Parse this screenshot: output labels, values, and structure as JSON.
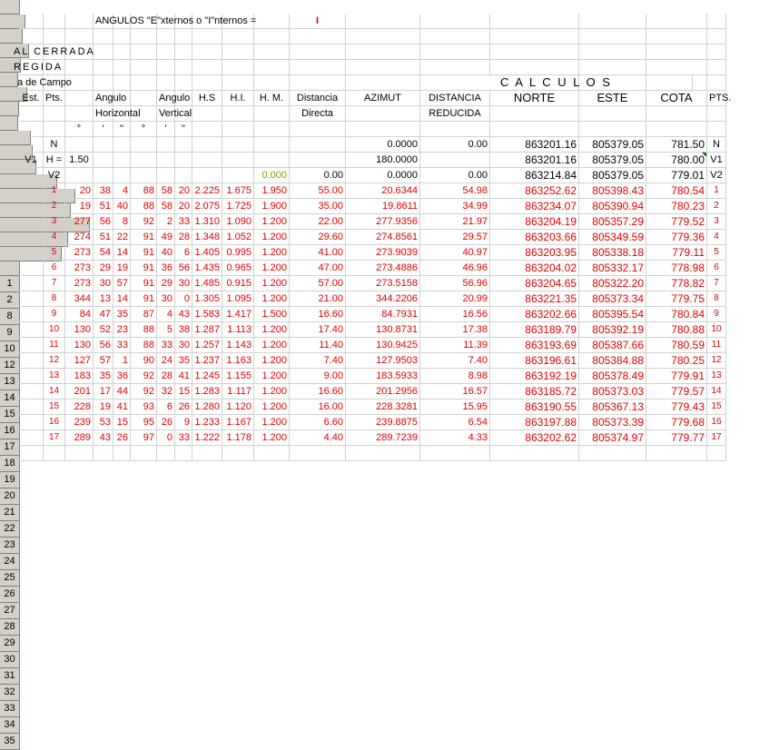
{
  "columns": [
    "A",
    "B",
    "C",
    "D",
    "E",
    "F",
    "G",
    "H",
    "I",
    "J",
    "K",
    "L",
    "U",
    "V",
    "W",
    "X",
    "Y",
    "Z"
  ],
  "texts": {
    "1": {
      "D": "ANGULOS  \"E\"xternos  o  \"I\"nternos  =",
      "L": "I"
    },
    "8": {
      "A": "AL  CERRADA"
    },
    "9": {
      "A": "REGIDA"
    },
    "10": {
      "A": "a  de  Campo",
      "V": "C A L C U L O S"
    },
    "12": {
      "A": "Est.",
      "B": "Pts.",
      "D": "Angulo",
      "G": "Angulo",
      "I": "H.S",
      "J": "H.I.",
      "K": "H. M.",
      "L": "Distancia",
      "U": "AZIMUT",
      "V": "DISTANCIA",
      "W": "NORTE",
      "X": "ESTE",
      "Y": "COTA",
      "Z": "PTS."
    },
    "13": {
      "D": "Horizontal",
      "G": "Vertical",
      "L": "Directa",
      "V": "REDUCIDA"
    },
    "14": {
      "C": "°",
      "D": "'",
      "E": "\"",
      "F": "°",
      "G": "'",
      "H": "\""
    },
    "15": {
      "B": "N",
      "U": "0.0000",
      "V": "0.00",
      "W": "863201.16",
      "X": "805379.05",
      "Y": "781.50",
      "Z": "N"
    },
    "16": {
      "A": "V1",
      "B": "H =",
      "C": "1.50",
      "U": "180.0000",
      "W": "863201.16",
      "X": "805379.05",
      "Y": "780.00",
      "Z": "V1"
    },
    "17": {
      "B": "V2",
      "K": "0.000",
      "L": "0.00",
      "U": "0.0000",
      "V": "0.00",
      "W": "863214.84",
      "X": "805379.05",
      "Y": "779.01",
      "Z": "V2"
    }
  },
  "data_rows": [
    {
      "row": "18",
      "pt": "1",
      "h_deg": "20",
      "h_min": "38",
      "h_sec": "4",
      "v_deg": "88",
      "v_min": "58",
      "v_sec": "20",
      "hs": "2.225",
      "hi": "1.675",
      "hm": "1.950",
      "dist": "55.00",
      "azimut": "20.6344",
      "dred": "54.98",
      "norte": "863252.62",
      "este": "805398.43",
      "cota": "780.54",
      "pts": "1"
    },
    {
      "row": "19",
      "pt": "2",
      "h_deg": "19",
      "h_min": "51",
      "h_sec": "40",
      "v_deg": "88",
      "v_min": "58",
      "v_sec": "20",
      "hs": "2.075",
      "hi": "1.725",
      "hm": "1.900",
      "dist": "35.00",
      "azimut": "19.8611",
      "dred": "34.99",
      "norte": "863234.07",
      "este": "805390.94",
      "cota": "780.23",
      "pts": "2"
    },
    {
      "row": "20",
      "pt": "3",
      "h_deg": "277",
      "h_min": "56",
      "h_sec": "8",
      "v_deg": "92",
      "v_min": "2",
      "v_sec": "33",
      "hs": "1.310",
      "hi": "1.090",
      "hm": "1.200",
      "dist": "22.00",
      "azimut": "277.9356",
      "dred": "21.97",
      "norte": "863204.19",
      "este": "805357.29",
      "cota": "779.52",
      "pts": "3"
    },
    {
      "row": "21",
      "pt": "4",
      "h_deg": "274",
      "h_min": "51",
      "h_sec": "22",
      "v_deg": "91",
      "v_min": "49",
      "v_sec": "28",
      "hs": "1.348",
      "hi": "1.052",
      "hm": "1.200",
      "dist": "29.60",
      "azimut": "274.8561",
      "dred": "29.57",
      "norte": "863203.66",
      "este": "805349.59",
      "cota": "779.36",
      "pts": "4"
    },
    {
      "row": "22",
      "pt": "5",
      "h_deg": "273",
      "h_min": "54",
      "h_sec": "14",
      "v_deg": "91",
      "v_min": "40",
      "v_sec": "6",
      "hs": "1.405",
      "hi": "0.995",
      "hm": "1.200",
      "dist": "41.00",
      "azimut": "273.9039",
      "dred": "40.97",
      "norte": "863203.95",
      "este": "805338.18",
      "cota": "779.11",
      "pts": "5"
    },
    {
      "row": "23",
      "pt": "6",
      "h_deg": "273",
      "h_min": "29",
      "h_sec": "19",
      "v_deg": "91",
      "v_min": "36",
      "v_sec": "56",
      "hs": "1.435",
      "hi": "0.965",
      "hm": "1.200",
      "dist": "47.00",
      "azimut": "273.4886",
      "dred": "46.96",
      "norte": "863204.02",
      "este": "805332.17",
      "cota": "778.98",
      "pts": "6"
    },
    {
      "row": "24",
      "pt": "7",
      "h_deg": "273",
      "h_min": "30",
      "h_sec": "57",
      "v_deg": "91",
      "v_min": "29",
      "v_sec": "30",
      "hs": "1.485",
      "hi": "0.915",
      "hm": "1.200",
      "dist": "57.00",
      "azimut": "273.5158",
      "dred": "56.96",
      "norte": "863204.65",
      "este": "805322.20",
      "cota": "778.82",
      "pts": "7"
    },
    {
      "row": "25",
      "pt": "8",
      "h_deg": "344",
      "h_min": "13",
      "h_sec": "14",
      "v_deg": "91",
      "v_min": "30",
      "v_sec": "0",
      "hs": "1.305",
      "hi": "1.095",
      "hm": "1.200",
      "dist": "21.00",
      "azimut": "344.2206",
      "dred": "20.99",
      "norte": "863221.35",
      "este": "805373.34",
      "cota": "779.75",
      "pts": "8"
    },
    {
      "row": "26",
      "pt": "9",
      "h_deg": "84",
      "h_min": "47",
      "h_sec": "35",
      "v_deg": "87",
      "v_min": "4",
      "v_sec": "43",
      "hs": "1.583",
      "hi": "1.417",
      "hm": "1.500",
      "dist": "16.60",
      "azimut": "84.7931",
      "dred": "16.56",
      "norte": "863202.66",
      "este": "805395.54",
      "cota": "780.84",
      "pts": "9"
    },
    {
      "row": "27",
      "pt": "10",
      "h_deg": "130",
      "h_min": "52",
      "h_sec": "23",
      "v_deg": "88",
      "v_min": "5",
      "v_sec": "38",
      "hs": "1.287",
      "hi": "1.113",
      "hm": "1.200",
      "dist": "17.40",
      "azimut": "130.8731",
      "dred": "17.38",
      "norte": "863189.79",
      "este": "805392.19",
      "cota": "780.88",
      "pts": "10"
    },
    {
      "row": "28",
      "pt": "11",
      "h_deg": "130",
      "h_min": "56",
      "h_sec": "33",
      "v_deg": "88",
      "v_min": "33",
      "v_sec": "30",
      "hs": "1.257",
      "hi": "1.143",
      "hm": "1.200",
      "dist": "11.40",
      "azimut": "130.9425",
      "dred": "11.39",
      "norte": "863193.69",
      "este": "805387.66",
      "cota": "780.59",
      "pts": "11"
    },
    {
      "row": "29",
      "pt": "12",
      "h_deg": "127",
      "h_min": "57",
      "h_sec": "1",
      "v_deg": "90",
      "v_min": "24",
      "v_sec": "35",
      "hs": "1.237",
      "hi": "1.163",
      "hm": "1.200",
      "dist": "7.40",
      "azimut": "127.9503",
      "dred": "7.40",
      "norte": "863196.61",
      "este": "805384.88",
      "cota": "780.25",
      "pts": "12"
    },
    {
      "row": "30",
      "pt": "13",
      "h_deg": "183",
      "h_min": "35",
      "h_sec": "36",
      "v_deg": "92",
      "v_min": "28",
      "v_sec": "41",
      "hs": "1.245",
      "hi": "1.155",
      "hm": "1.200",
      "dist": "9.00",
      "azimut": "183.5933",
      "dred": "8.98",
      "norte": "863192.19",
      "este": "805378.49",
      "cota": "779.91",
      "pts": "13"
    },
    {
      "row": "31",
      "pt": "14",
      "h_deg": "201",
      "h_min": "17",
      "h_sec": "44",
      "v_deg": "92",
      "v_min": "32",
      "v_sec": "15",
      "hs": "1.283",
      "hi": "1.117",
      "hm": "1.200",
      "dist": "16.60",
      "azimut": "201.2956",
      "dred": "16.57",
      "norte": "863185.72",
      "este": "805373.03",
      "cota": "779.57",
      "pts": "14"
    },
    {
      "row": "32",
      "pt": "15",
      "h_deg": "228",
      "h_min": "19",
      "h_sec": "41",
      "v_deg": "93",
      "v_min": "6",
      "v_sec": "26",
      "hs": "1.280",
      "hi": "1.120",
      "hm": "1.200",
      "dist": "16.00",
      "azimut": "228.3281",
      "dred": "15.95",
      "norte": "863190.55",
      "este": "805367.13",
      "cota": "779.43",
      "pts": "15"
    },
    {
      "row": "33",
      "pt": "16",
      "h_deg": "239",
      "h_min": "53",
      "h_sec": "15",
      "v_deg": "95",
      "v_min": "26",
      "v_sec": "9",
      "hs": "1.233",
      "hi": "1.167",
      "hm": "1.200",
      "dist": "6.60",
      "azimut": "239.8875",
      "dred": "6.54",
      "norte": "863197.88",
      "este": "805373.39",
      "cota": "779.68",
      "pts": "16"
    },
    {
      "row": "34",
      "pt": "17",
      "h_deg": "289",
      "h_min": "43",
      "h_sec": "26",
      "v_deg": "97",
      "v_min": "0",
      "v_sec": "33",
      "hs": "1.222",
      "hi": "1.178",
      "hm": "1.200",
      "dist": "4.40",
      "azimut": "289.7239",
      "dred": "4.33",
      "norte": "863202.62",
      "este": "805374.97",
      "cota": "779.77",
      "pts": "17"
    }
  ],
  "colors": {
    "header_bg": "#d4d0c8",
    "grid": "#d0d0d0",
    "red": "#e00000",
    "green": "#8a9a00",
    "comment_marker": "#008000"
  }
}
